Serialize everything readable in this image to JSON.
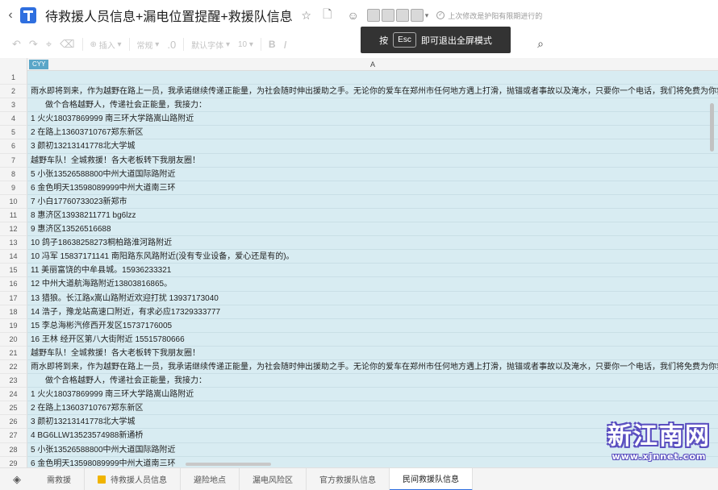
{
  "header": {
    "title": "待救援人员信息+漏电位置提醒+救援队信息",
    "save_status": "上次修改是护阳有限期进行的"
  },
  "toolbar": {
    "insert_label": "插入",
    "table_label": "常规",
    "font_label": "默认字体",
    "size_label": "10",
    "bold_label": "B"
  },
  "toast": {
    "prefix": "按",
    "key": "Esc",
    "suffix": "即可退出全屏模式"
  },
  "sheet": {
    "column_label": "A",
    "collaborator_tag": "CYY",
    "rows": [
      {
        "n": "1",
        "text": ""
      },
      {
        "n": "2",
        "text": "雨水即将到来，作为越野在路上一员，我承诺继续传递正能量，为社会随时伸出援助之手。无论你的爱车在郑州市任何地方遇上打滑，抛锚或者事故以及淹水，只要你一个电话，我们将免费为你救援始于援手"
      },
      {
        "n": "3",
        "text": "做个合格越野人，传递社会正能量，我接力：",
        "indent": true
      },
      {
        "n": "4",
        "text": "1 火火18037869999 南三环大学路嵩山路附近"
      },
      {
        "n": "5",
        "text": "2 在路上13603710767郑东新区"
      },
      {
        "n": "6",
        "text": "3 颜初13213141778北大学城"
      },
      {
        "n": "7",
        "text": "越野车队！全城救援！各大老板转下我朋友圈！"
      },
      {
        "n": "8",
        "text": "5 小张13526588800中州大道国际路附近"
      },
      {
        "n": "9",
        "text": "6 金色明天13598089999中州大道南三环"
      },
      {
        "n": "10",
        "text": "7 小白17760733023新郑市"
      },
      {
        "n": "11",
        "text": "8 惠济区13938211771 bg6lzz"
      },
      {
        "n": "12",
        "text": "9 惠济区13526516688"
      },
      {
        "n": "13",
        "text": "10 鸽子18638258273桐柏路淮河路附近"
      },
      {
        "n": "14",
        "text": "10 冯军 15837171141 南阳路东风路附近(没有专业设备，爱心还是有的)。"
      },
      {
        "n": "15",
        "text": "11 美丽富饶的中牟县城。15936233321"
      },
      {
        "n": "16",
        "text": "12 中州大道航海路附近13803816865。"
      },
      {
        "n": "17",
        "text": "13 猎狼。长江路x嵩山路附近欢迎打扰 13937173040"
      },
      {
        "n": "18",
        "text": "14 浩子，豫龙站高速口附近，有求必应17329333777"
      },
      {
        "n": "19",
        "text": "15 李总海彬汽修西开发区15737176005"
      },
      {
        "n": "20",
        "text": "16 王林 经开区第八大街附近 15515780666"
      },
      {
        "n": "21",
        "text": "越野车队！全城救援！各大老板转下我朋友圈！"
      },
      {
        "n": "22",
        "text": "雨水即将到来，作为越野在路上一员，我承诺继续传递正能量，为社会随时伸出援助之手。无论你的爱车在郑州市任何地方遇上打滑，抛锚或者事故以及淹水，只要你一个电话，我们将免费为你救援始于援手"
      },
      {
        "n": "23",
        "text": "做个合格越野人，传递社会正能量，我接力：",
        "indent": true
      },
      {
        "n": "24",
        "text": "1 火火18037869999 南三环大学路嵩山路附近"
      },
      {
        "n": "25",
        "text": "2 在路上13603710767郑东新区"
      },
      {
        "n": "26",
        "text": "3 颜初13213141778北大学城"
      },
      {
        "n": "27",
        "text": "4 BG6LLW13523574988新通桥"
      },
      {
        "n": "28",
        "text": "5 小张13526588800中州大道国际路附近"
      },
      {
        "n": "29",
        "text": "6 金色明天13598089999中州大道南三环"
      }
    ]
  },
  "tabs": [
    {
      "label": "需救援"
    },
    {
      "label": "待救援人员信息"
    },
    {
      "label": "避险地点"
    },
    {
      "label": "漏电风险区"
    },
    {
      "label": "官方救援队信息"
    },
    {
      "label": "民间救援队信息"
    }
  ],
  "watermark": {
    "big": "新江南网",
    "url": "www.xjnnet.com"
  }
}
